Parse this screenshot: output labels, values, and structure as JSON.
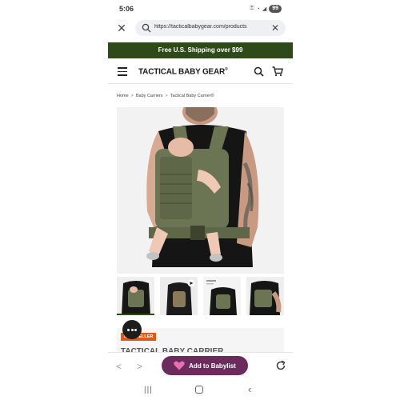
{
  "status_bar": {
    "time": "5:06",
    "battery": "99"
  },
  "browser": {
    "url": "https://tacticalbabygear.com/products",
    "close_icon": "close-icon",
    "clear_icon": "close-icon"
  },
  "promo": {
    "text": "Free U.S. Shipping over $99"
  },
  "header": {
    "brand": "TACTICAL BABY GEAR",
    "brand_mark": "®"
  },
  "breadcrumb": {
    "items": [
      "Home",
      "Baby Carriers",
      "Tactical Baby Carrier®"
    ],
    "separator": ">"
  },
  "product": {
    "badge": "BESTSELLER",
    "title": "TACTICAL BABY CARRIER",
    "thumbnail_count": 4
  },
  "bottom_bar": {
    "back_glyph": "<",
    "forward_glyph": ">",
    "babylist_label": "Add to Babylist"
  },
  "colors": {
    "promo_bg": "#2f4a19",
    "babylist_bg": "#6b2c5d",
    "badge_bg": "#e05a16",
    "heart": "#e76fb5",
    "carrier_green": "#6b7453"
  }
}
